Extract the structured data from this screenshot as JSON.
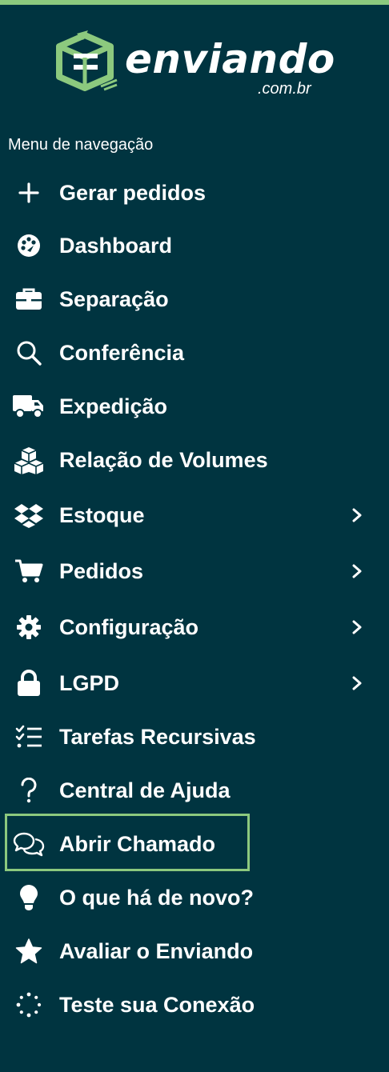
{
  "brand": {
    "name": "enviando",
    "domain_suffix": ".com.br",
    "accent": "#8cc97e",
    "background": "#003440"
  },
  "nav": {
    "title": "Menu de navegação",
    "items": [
      {
        "label": "Gerar pedidos",
        "icon": "plus-icon",
        "has_submenu": false
      },
      {
        "label": "Dashboard",
        "icon": "palette-dashboard-icon",
        "has_submenu": false
      },
      {
        "label": "Separação",
        "icon": "briefcase-icon",
        "has_submenu": false
      },
      {
        "label": "Conferência",
        "icon": "search-icon",
        "has_submenu": false
      },
      {
        "label": "Expedição",
        "icon": "truck-icon",
        "has_submenu": false
      },
      {
        "label": "Relação de Volumes",
        "icon": "cubes-icon",
        "has_submenu": false
      },
      {
        "label": "Estoque",
        "icon": "dropbox-icon",
        "has_submenu": true
      },
      {
        "label": "Pedidos",
        "icon": "cart-icon",
        "has_submenu": true
      },
      {
        "label": "Configuração",
        "icon": "gear-icon",
        "has_submenu": true
      },
      {
        "label": "LGPD",
        "icon": "lock-icon",
        "has_submenu": true
      },
      {
        "label": "Tarefas Recursivas",
        "icon": "checklist-icon",
        "has_submenu": false
      },
      {
        "label": "Central de Ajuda",
        "icon": "question-icon",
        "has_submenu": false
      },
      {
        "label": "Abrir Chamado",
        "icon": "chat-bubbles-icon",
        "has_submenu": false,
        "highlighted": true
      },
      {
        "label": "O que há de novo?",
        "icon": "lightbulb-icon",
        "has_submenu": false
      },
      {
        "label": "Avaliar o Enviando",
        "icon": "star-icon",
        "has_submenu": false
      },
      {
        "label": "Teste sua Conexão",
        "icon": "spinner-icon",
        "has_submenu": false
      }
    ]
  }
}
